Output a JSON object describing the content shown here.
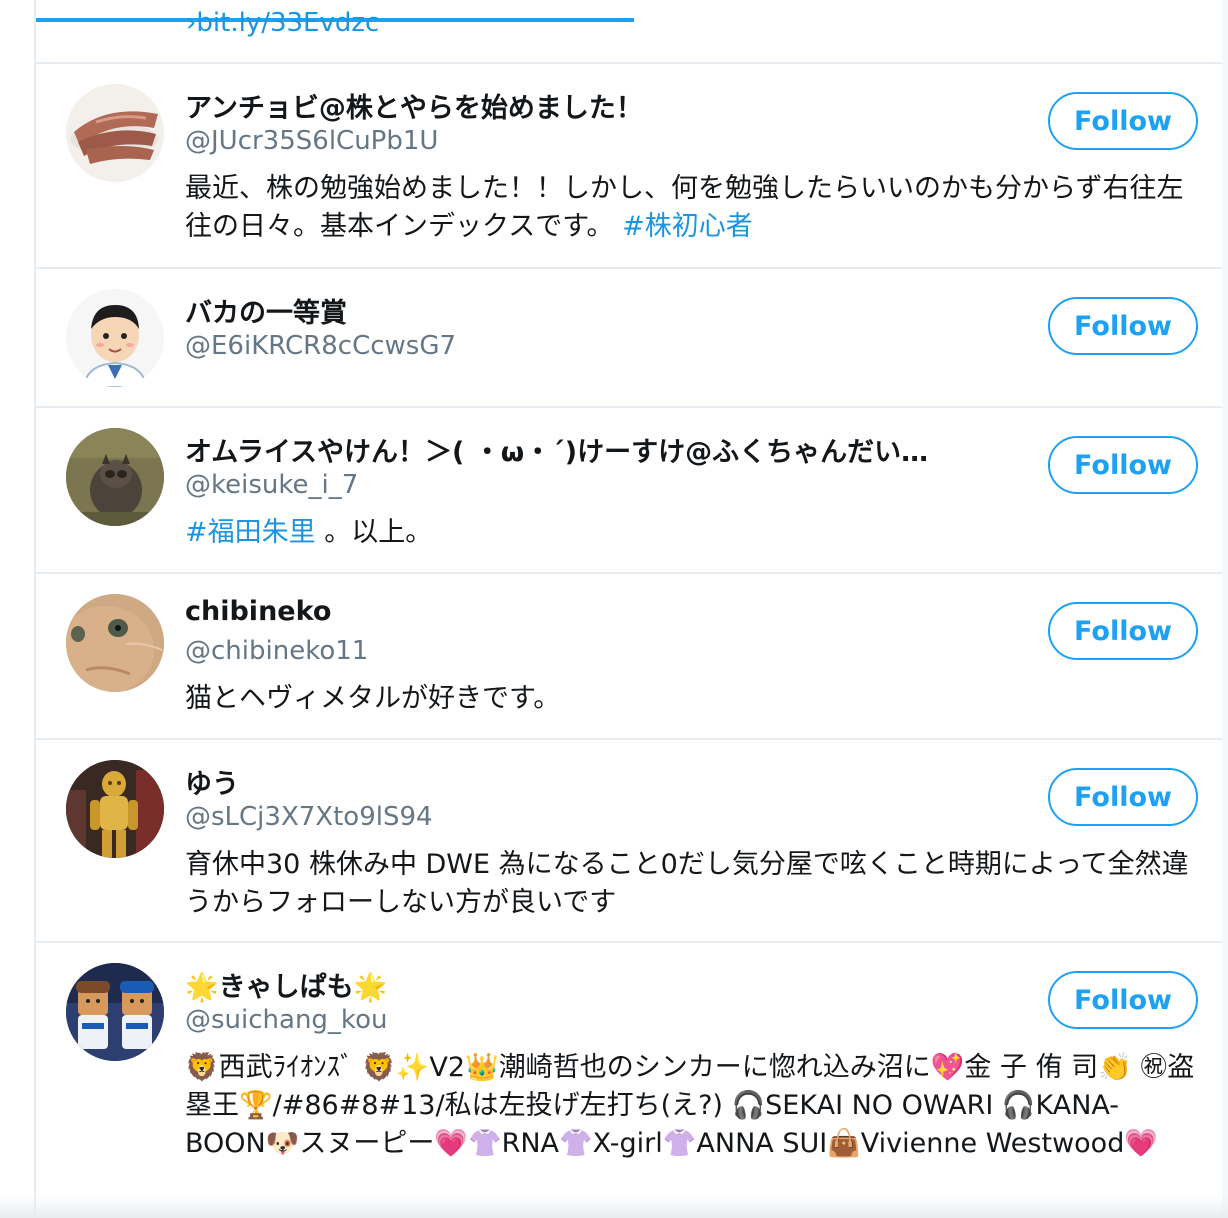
{
  "top_link": "›bit.ly/33Evdzc",
  "follow_label": "Follow",
  "users": [
    {
      "name": "アンチョビ@株とやらを始めました！",
      "handle": "@JUcr35S6lCuPb1U",
      "bio": "最近、株の勉強始めました！！しかし、何を勉強したらいいのかも分からず右往左往の日々。基本インデックスです。",
      "hashtag": "#株初心者",
      "avatar": "anchovy-photo"
    },
    {
      "name": "バカの一等賞",
      "handle": "@E6iKRCR8cCcwsG7",
      "bio": "",
      "avatar": "man-illustration"
    },
    {
      "name": "オムライスやけん！＞( ・ω・´)けーすけ@ふくちゃんだい…",
      "handle": "@keisuke_i_7",
      "hashtag": "#福田朱里",
      "bio_after": " 。以上。",
      "avatar": "raccoon-dog-photo"
    },
    {
      "name": "chibineko",
      "handle": "@chibineko11",
      "bio": "猫とヘヴィメタルが好きです。",
      "avatar": "cat-photo"
    },
    {
      "name": "ゆう",
      "handle": "@sLCj3X7Xto9lS94",
      "bio": "育休中30 株休み中 DWE 為になること0だし気分屋で呟くこと時期によって全然違うからフォローしない方が良いです",
      "avatar": "gold-robot-photo"
    },
    {
      "name": "🌟きゃしぱも🌟",
      "handle": "@suichang_kou",
      "bio": "🦁西武ﾗｲｵﾝｽﾞ 🦁✨V2👑潮崎哲也のシンカーに惚れ込み沼に💖金 子 侑 司👏 ㊗盗塁王🏆/#86#8#13/私は左投げ左打ち(え?) 🎧SEKAI NO OWARI 🎧KANA-BOON🐶スヌーピー💗👚RNA👚X-girl👚ANNA SUI👜Vivienne Westwood💗",
      "avatar": "baseball-dolls-photo"
    }
  ]
}
